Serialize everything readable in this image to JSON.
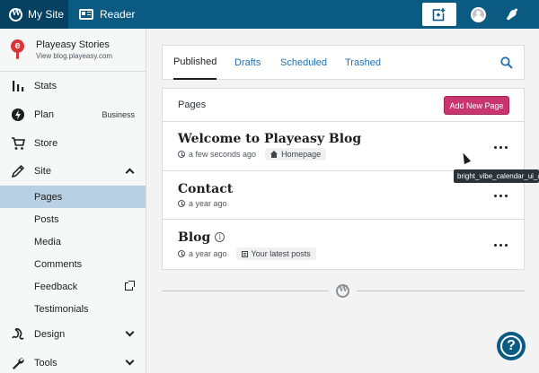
{
  "topbar": {
    "my_site_label": "My Site",
    "reader_label": "Reader",
    "icons": [
      "wordpress-icon",
      "reader-icon",
      "write-icon",
      "avatar",
      "notifications-icon"
    ]
  },
  "site": {
    "name": "Playeasy Stories",
    "url_label": "View blog.playeasy.com"
  },
  "sidebar": {
    "stats": "Stats",
    "plan": "Plan",
    "plan_badge": "Business",
    "store": "Store",
    "site": "Site",
    "sub_items": [
      "Pages",
      "Posts",
      "Media",
      "Comments",
      "Feedback",
      "Testimonials"
    ],
    "design": "Design",
    "tools": "Tools"
  },
  "tabs": {
    "published": "Published",
    "drafts": "Drafts",
    "scheduled": "Scheduled",
    "trashed": "Trashed"
  },
  "pages_card": {
    "title": "Pages",
    "add_button": "Add New Page",
    "rows": [
      {
        "title": "Welcome to Playeasy Blog",
        "time": "a few seconds ago",
        "badge": "Homepage"
      },
      {
        "title": "Contact",
        "time": "a year ago",
        "badge": ""
      },
      {
        "title": "Blog",
        "time": "a year ago",
        "badge": "Your latest posts"
      }
    ]
  },
  "tooltip": "bright_vibe_calendar_ui_a",
  "help_label": "?",
  "colors": {
    "topbar": "#0b5a82",
    "topbar_active": "#064161",
    "sidebar_active": "#b8cfe4",
    "primary_button": "#c9356e",
    "link": "#2271b1"
  }
}
